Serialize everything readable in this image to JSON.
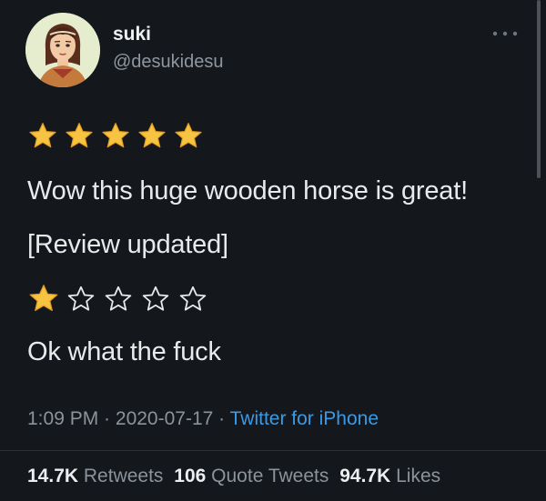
{
  "user": {
    "display_name": "suki",
    "handle": "@desukidesu"
  },
  "tweet": {
    "rating_before": 5,
    "line1": "Wow this huge wooden horse is great!",
    "line2": "[Review updated]",
    "rating_after": 1,
    "rating_max": 5,
    "line3": "Ok what the fuck"
  },
  "meta": {
    "time": "1:09 PM",
    "separator": " · ",
    "date": "2020-07-17",
    "source": "Twitter for iPhone"
  },
  "stats": {
    "retweets_count": "14.7K",
    "retweets_label": "Retweets",
    "quotes_count": "106",
    "quotes_label": "Quote Tweets",
    "likes_count": "94.7K",
    "likes_label": "Likes"
  },
  "icons": {
    "more": "more-icon",
    "filled_star": "star-filled-icon",
    "empty_star": "star-outline-icon"
  },
  "colors": {
    "background": "#14171c",
    "star_fill": "#f6c343",
    "link": "#3b9ae4",
    "muted": "#8b939b"
  }
}
